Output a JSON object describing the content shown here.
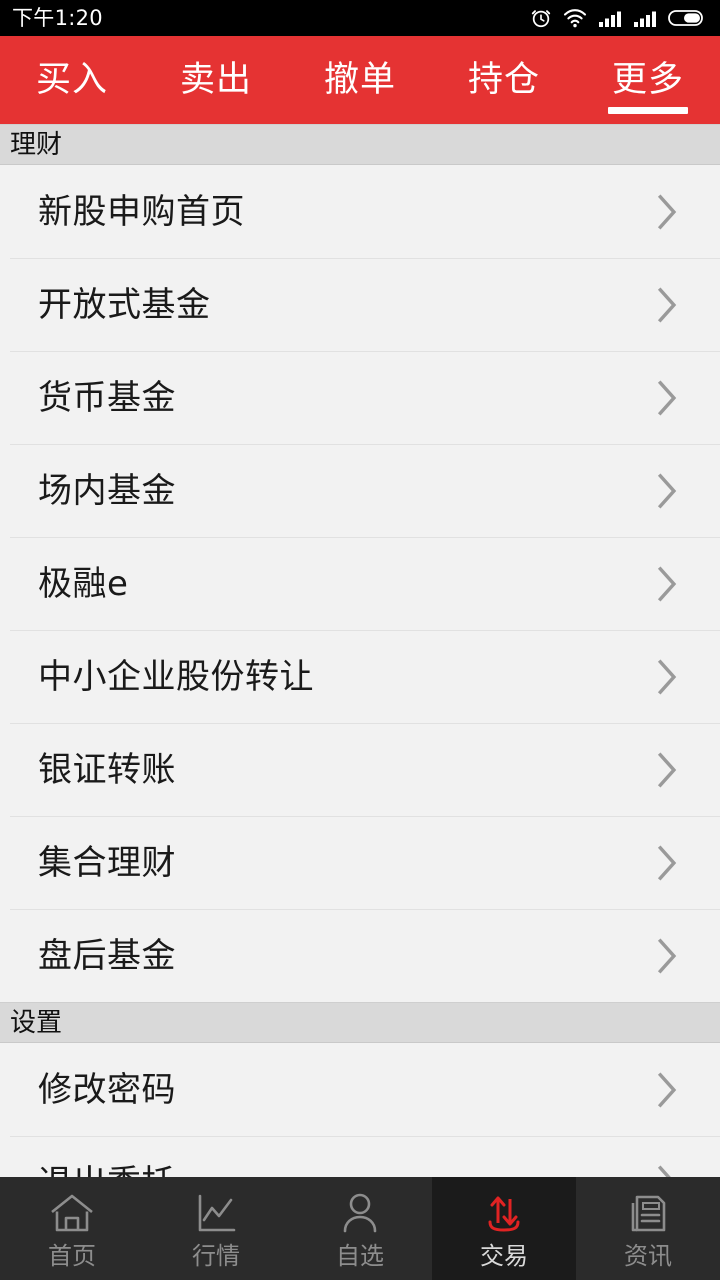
{
  "status_bar": {
    "time": "下午1:20",
    "icons": [
      "alarm-icon",
      "wifi-icon",
      "signal-icon-1",
      "signal-icon-2",
      "battery-icon"
    ]
  },
  "top_tabs": {
    "items": [
      {
        "label": "买入",
        "active": false
      },
      {
        "label": "卖出",
        "active": false
      },
      {
        "label": "撤单",
        "active": false
      },
      {
        "label": "持仓",
        "active": false
      },
      {
        "label": "更多",
        "active": true
      }
    ]
  },
  "sections": [
    {
      "title": "理财",
      "items": [
        {
          "label": "新股申购首页"
        },
        {
          "label": "开放式基金"
        },
        {
          "label": "货币基金"
        },
        {
          "label": "场内基金"
        },
        {
          "label": "极融e"
        },
        {
          "label": "中小企业股份转让"
        },
        {
          "label": "银证转账"
        },
        {
          "label": "集合理财"
        },
        {
          "label": "盘后基金"
        }
      ]
    },
    {
      "title": "设置",
      "items": [
        {
          "label": "修改密码"
        },
        {
          "label": "退出委托"
        }
      ]
    }
  ],
  "bottom_nav": {
    "items": [
      {
        "label": "首页",
        "icon": "home-icon",
        "active": false
      },
      {
        "label": "行情",
        "icon": "chart-icon",
        "active": false
      },
      {
        "label": "自选",
        "icon": "person-icon",
        "active": false
      },
      {
        "label": "交易",
        "icon": "trade-arrows-icon",
        "active": true
      },
      {
        "label": "资讯",
        "icon": "news-icon",
        "active": false
      }
    ]
  },
  "colors": {
    "accent_red": "#e53333",
    "header_gray": "#d9d9d9",
    "row_bg": "#f2f2f2",
    "nav_bg": "#2b2b2b",
    "nav_active_bg": "#1b1b1b"
  }
}
